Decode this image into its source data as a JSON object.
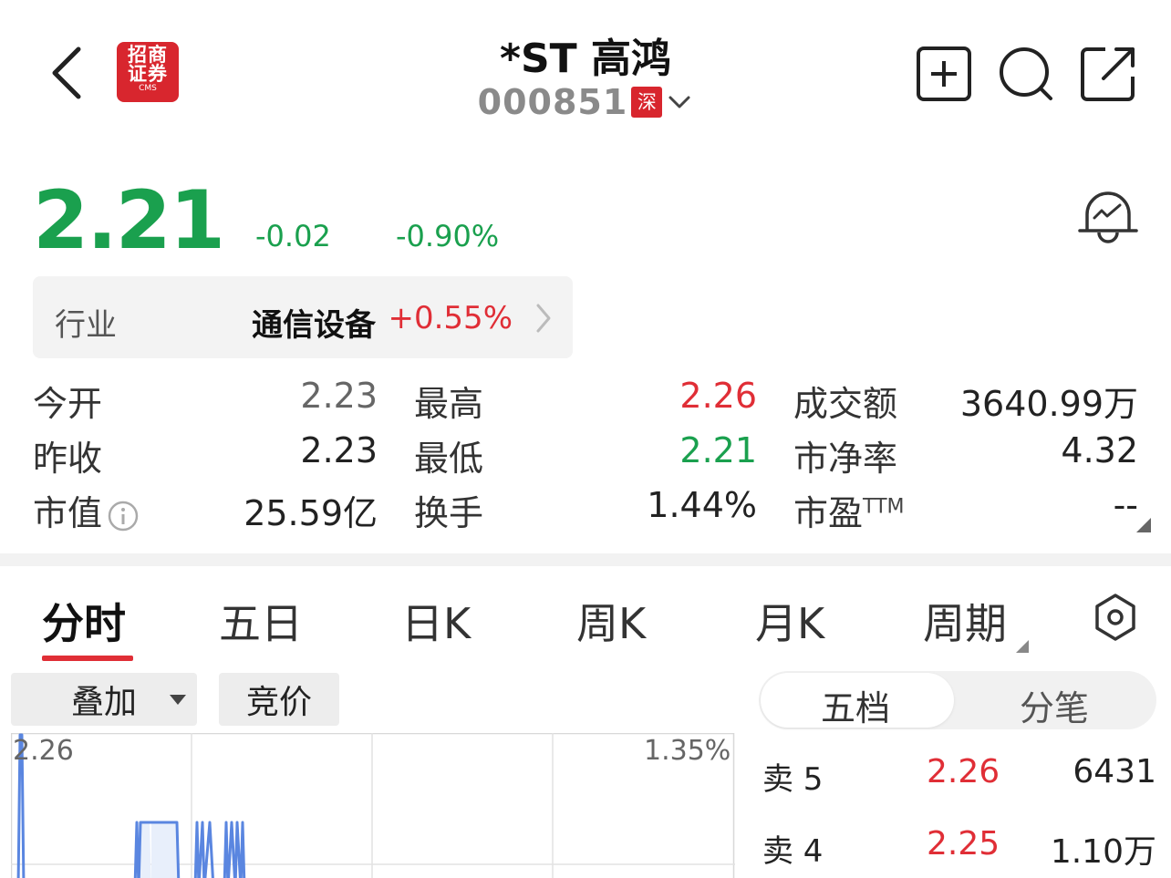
{
  "header": {
    "logo_line1": "招商",
    "logo_line2": "证券",
    "logo_line3": "CMS",
    "title": "*ST 高鸿",
    "code": "000851",
    "market": "深"
  },
  "quote": {
    "price": "2.21",
    "change": "-0.02",
    "change_pct": "-0.90%"
  },
  "industry": {
    "label": "行业",
    "name": "通信设备",
    "pct": "+0.55%"
  },
  "stats": {
    "open_label": "今开",
    "open": "2.23",
    "high_label": "最高",
    "high": "2.26",
    "turnover_amt_label": "成交额",
    "turnover_amt": "3640.99万",
    "prev_close_label": "昨收",
    "prev_close": "2.23",
    "low_label": "最低",
    "low": "2.21",
    "pb_label": "市净率",
    "pb": "4.32",
    "mcap_label": "市值",
    "mcap": "25.59亿",
    "turnover_label": "换手",
    "turnover": "1.44%",
    "pe_label": "市盈",
    "pe_sup": "TTM",
    "pe": "--"
  },
  "tabs": [
    "分时",
    "五日",
    "日K",
    "周K",
    "月K",
    "周期"
  ],
  "chart_controls": {
    "overlay": "叠加",
    "auction": "竞价",
    "seg_left": "五档",
    "seg_right": "分笔"
  },
  "chart_data": {
    "type": "line",
    "y_max_label": "2.26",
    "y_max_pct_label": "1.35%",
    "grid": true
  },
  "order_book": [
    {
      "label": "卖 5",
      "price": "2.26",
      "volume": "6431"
    },
    {
      "label": "卖 4",
      "price": "2.25",
      "volume": "1.10万"
    }
  ],
  "colors": {
    "up": "#e02e36",
    "down": "#1aa04e",
    "brand": "#d8262e"
  }
}
